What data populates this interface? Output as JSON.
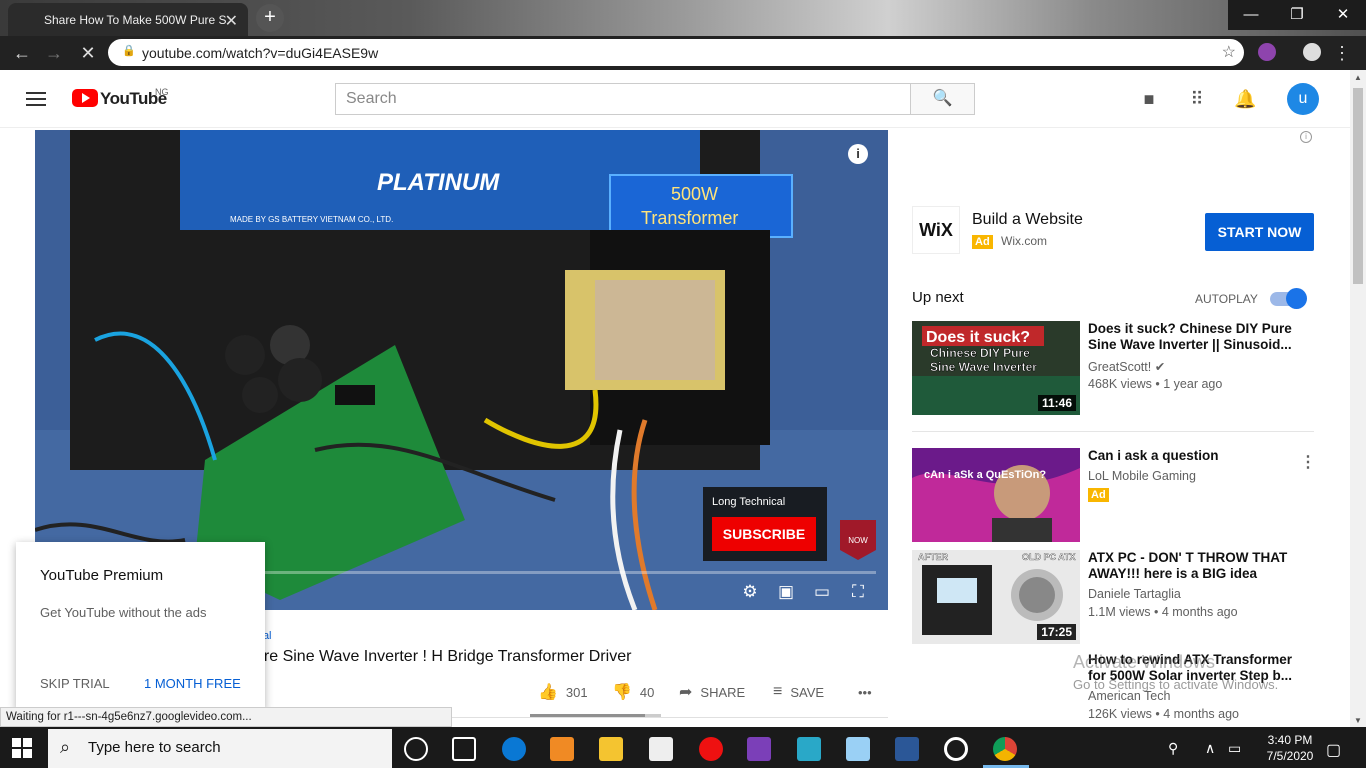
{
  "browser": {
    "tab_title": "Share How To Make 500W Pure S",
    "tab_close": "✕",
    "new_tab": "+",
    "url": "youtube.com/watch?v=duGi4EASE9w",
    "status_text": "Waiting for r1---sn-4g5e6nz7.googlevideo.com..."
  },
  "youtube": {
    "logo_text": "YouTube",
    "region": "NG",
    "search_placeholder": "Search",
    "avatar_letter": "u"
  },
  "player": {
    "overlay_label_1": "500W",
    "overlay_label_2": "Transformer",
    "battery_brand": "PLATINUM",
    "battery_sub": "MADE BY GS BATTERY VIETNAM CO., LTD.",
    "subscribe_channel": "Long Technical",
    "subscribe_label": "SUBSCRIBE",
    "watermark": "NOW"
  },
  "video": {
    "channel_link": "ical",
    "title": "ure Sine Wave Inverter ! H Bridge Transformer Driver",
    "likes": "301",
    "dislikes": "40",
    "share_label": "SHARE",
    "save_label": "SAVE",
    "like_ratio": 0.88
  },
  "premium_popup": {
    "title": "YouTube Premium",
    "description": "Get YouTube without the ads",
    "skip_label": "SKIP TRIAL",
    "free_label": "1 MONTH FREE"
  },
  "ad": {
    "logo": "WiX",
    "title": "Build a Website",
    "badge": "Ad",
    "domain": "Wix.com",
    "cta": "START NOW"
  },
  "sidebar": {
    "up_next": "Up next",
    "autoplay": "AUTOPLAY",
    "autoplay_on": true,
    "videos": [
      {
        "title": "Does it suck? Chinese DIY Pure Sine Wave Inverter || Sinusoid...",
        "channel": "GreatScott!",
        "meta": "468K views • 1 year ago",
        "duration": "11:46",
        "thumb_text_1": "Does it suck?",
        "thumb_text_2": "Chinese DIY Pure",
        "thumb_text_3": "Sine Wave Inverter"
      },
      {
        "title": "Can i ask a question",
        "channel": "LoL Mobile Gaming",
        "badge": "Ad",
        "thumb_text": "cAn i aSk a QuEsTiOn?"
      },
      {
        "title": "ATX PC - DON' T THROW THAT AWAY!!! here is a BIG idea",
        "channel": "Daniele Tartaglia",
        "meta": "1.1M views • 4 months ago",
        "duration": "17:25",
        "thumb_text_1": "AFTER",
        "thumb_text_2": "OLD PC ATX"
      },
      {
        "title": "How to rewind ATX Transformer for 500W Solar inverter Step b...",
        "channel": "American Tech",
        "meta": "126K views • 4 months ago"
      }
    ]
  },
  "windows": {
    "activate_1": "Activate Windows",
    "activate_2": "Go to Settings to activate Windows.",
    "taskbar_search": "Type here to search",
    "time": "3:40 PM",
    "date": "7/5/2020"
  },
  "colors": {
    "yt_red": "#ff0000",
    "link_blue": "#065fd4",
    "ad_yellow": "#f9b600"
  }
}
